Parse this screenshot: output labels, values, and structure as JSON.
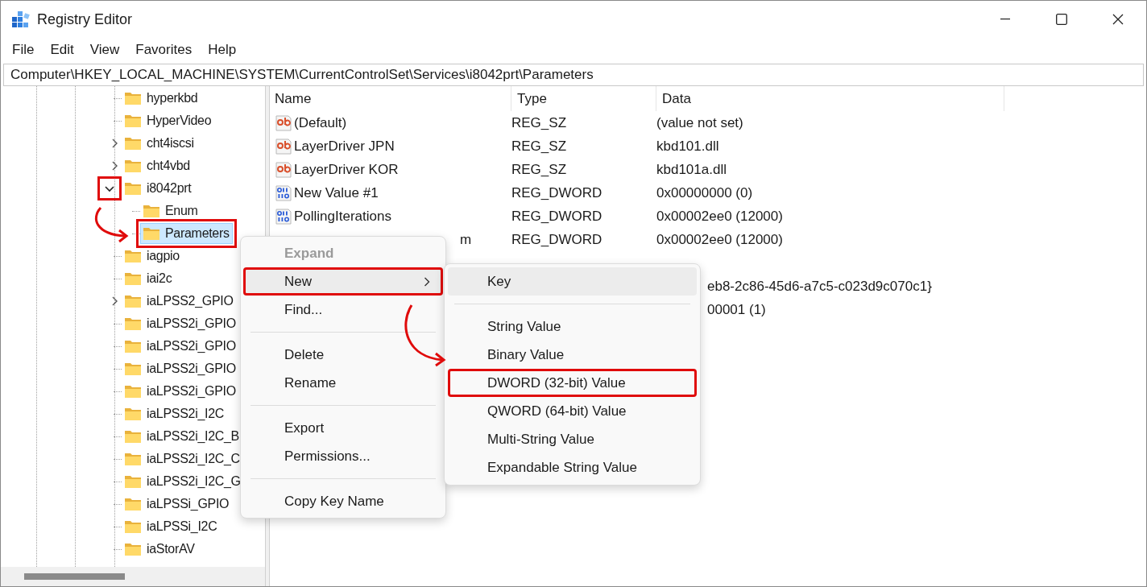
{
  "window": {
    "title": "Registry Editor"
  },
  "menu_bar": [
    "File",
    "Edit",
    "View",
    "Favorites",
    "Help"
  ],
  "address_bar": {
    "value": "Computer\\HKEY_LOCAL_MACHINE\\SYSTEM\\CurrentControlSet\\Services\\i8042prt\\Parameters"
  },
  "tree": [
    {
      "label": "hyperkbd",
      "selected": false,
      "annotated": false
    },
    {
      "label": "HyperVideo",
      "selected": false,
      "annotated": false
    },
    {
      "label": "cht4iscsi",
      "expanded": false,
      "expander_annotated": false,
      "selected": false,
      "annotated": false
    },
    {
      "label": "cht4vbd",
      "expanded": false,
      "expander_annotated": false,
      "selected": false,
      "annotated": false
    },
    {
      "label": "i8042prt",
      "expanded": true,
      "expander_annotated": true,
      "selected": false,
      "annotated": false,
      "children": [
        {
          "label": "Enum",
          "selected": false,
          "annotated": false
        },
        {
          "label": "Parameters",
          "selected": true,
          "annotated": true
        }
      ]
    },
    {
      "label": "iagpio",
      "selected": false,
      "annotated": false
    },
    {
      "label": "iai2c",
      "selected": false,
      "annotated": false
    },
    {
      "label": "iaLPSS2_GPIO",
      "expanded": false,
      "expander_annotated": false,
      "selected": false,
      "annotated": false
    },
    {
      "label": "iaLPSS2i_GPIO",
      "selected": false,
      "annotated": false
    },
    {
      "label": "iaLPSS2i_GPIO",
      "selected": false,
      "annotated": false
    },
    {
      "label": "iaLPSS2i_GPIO",
      "selected": false,
      "annotated": false
    },
    {
      "label": "iaLPSS2i_GPIO",
      "selected": false,
      "annotated": false
    },
    {
      "label": "iaLPSS2i_I2C",
      "selected": false,
      "annotated": false
    },
    {
      "label": "iaLPSS2i_I2C_B",
      "selected": false,
      "annotated": false
    },
    {
      "label": "iaLPSS2i_I2C_C",
      "selected": false,
      "annotated": false
    },
    {
      "label": "iaLPSS2i_I2C_G",
      "selected": false,
      "annotated": false
    },
    {
      "label": "iaLPSSi_GPIO",
      "selected": false,
      "annotated": false
    },
    {
      "label": "iaLPSSi_I2C",
      "selected": false,
      "annotated": false
    },
    {
      "label": "iaStorAV",
      "selected": false,
      "annotated": false
    }
  ],
  "list": {
    "columns": [
      "Name",
      "Type",
      "Data"
    ],
    "rows": [
      {
        "kind": "string",
        "name": "(Default)",
        "type": "REG_SZ",
        "data": "(value not set)"
      },
      {
        "kind": "string",
        "name": "LayerDriver JPN",
        "type": "REG_SZ",
        "data": "kbd101.dll"
      },
      {
        "kind": "string",
        "name": "LayerDriver KOR",
        "type": "REG_SZ",
        "data": "kbd101a.dll"
      },
      {
        "kind": "dword",
        "name": "New Value #1",
        "type": "REG_DWORD",
        "data": "0x00000000 (0)"
      },
      {
        "kind": "dword",
        "name": "PollingIterations",
        "type": "REG_DWORD",
        "data": "0x00002ee0 (12000)"
      },
      {
        "kind": "behind_menu",
        "name": "m",
        "type": "REG_DWORD",
        "data": "0x00002ee0 (12000)"
      },
      {
        "kind": "covered"
      },
      {
        "kind": "behind_submenu",
        "data": "eb8-2c86-45d6-a7c5-c023d9c070c1}"
      },
      {
        "kind": "behind_submenu",
        "data": "00001 (1)"
      }
    ]
  },
  "context_menu": [
    {
      "kind": "item",
      "label": "Expand",
      "disabled": true,
      "highlighted": false,
      "annotated": false
    },
    {
      "kind": "item",
      "label": "New",
      "submenu": true,
      "disabled": false,
      "highlighted": true,
      "annotated": true
    },
    {
      "kind": "item",
      "label": "Find...",
      "disabled": false,
      "highlighted": false,
      "annotated": false
    },
    {
      "kind": "separator"
    },
    {
      "kind": "item",
      "label": "Delete",
      "disabled": false,
      "highlighted": false,
      "annotated": false
    },
    {
      "kind": "item",
      "label": "Rename",
      "disabled": false,
      "highlighted": false,
      "annotated": false
    },
    {
      "kind": "separator"
    },
    {
      "kind": "item",
      "label": "Export",
      "disabled": false,
      "highlighted": false,
      "annotated": false
    },
    {
      "kind": "item",
      "label": "Permissions...",
      "disabled": false,
      "highlighted": false,
      "annotated": false
    },
    {
      "kind": "separator"
    },
    {
      "kind": "item",
      "label": "Copy Key Name",
      "disabled": false,
      "highlighted": false,
      "annotated": false
    }
  ],
  "submenu": [
    {
      "kind": "item",
      "label": "Key",
      "highlighted": true,
      "annotated": false
    },
    {
      "kind": "separator"
    },
    {
      "kind": "item",
      "label": "String Value",
      "highlighted": false,
      "annotated": false
    },
    {
      "kind": "item",
      "label": "Binary Value",
      "highlighted": false,
      "annotated": false
    },
    {
      "kind": "item",
      "label": "DWORD (32-bit) Value",
      "highlighted": false,
      "annotated": true
    },
    {
      "kind": "item",
      "label": "QWORD (64-bit) Value",
      "highlighted": false,
      "annotated": false
    },
    {
      "kind": "item",
      "label": "Multi-String Value",
      "highlighted": false,
      "annotated": false
    },
    {
      "kind": "item",
      "label": "Expandable String Value",
      "highlighted": false,
      "annotated": false
    }
  ]
}
